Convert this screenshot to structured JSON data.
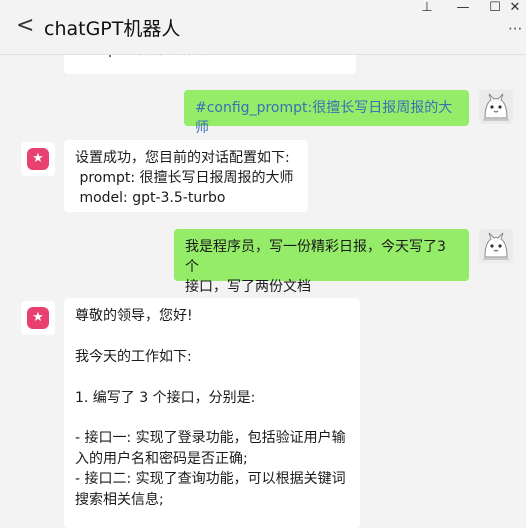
{
  "window": {
    "title": "chatGPT机器人",
    "back_glyph": "<",
    "pin_glyph": "⊥",
    "min_glyph": "—",
    "max_glyph": "☐",
    "close_glyph": "✕",
    "more_glyph": "···"
  },
  "messages": [
    {
      "from": "bot",
      "text": "#help 查看所有指令"
    },
    {
      "from": "me",
      "text": "#config_prompt:很擅长写日报周报的大师"
    },
    {
      "from": "bot",
      "text": "设置成功，您目前的对话配置如下:\n prompt: 很擅长写日报周报的大师\n model: gpt-3.5-turbo"
    },
    {
      "from": "me",
      "text": "我是程序员，写一份精彩日报，今天写了3个\n接口，写了两份文档"
    },
    {
      "from": "bot",
      "text": "尊敬的领导，您好!\n\n我今天的工作如下:\n\n1. 编写了 3 个接口，分别是:\n\n- 接口一: 实现了登录功能，包括验证用户输\n入的用户名和密码是否正确;\n- 接口二: 实现了查询功能，可以根据关键词\n搜索相关信息;"
    }
  ]
}
